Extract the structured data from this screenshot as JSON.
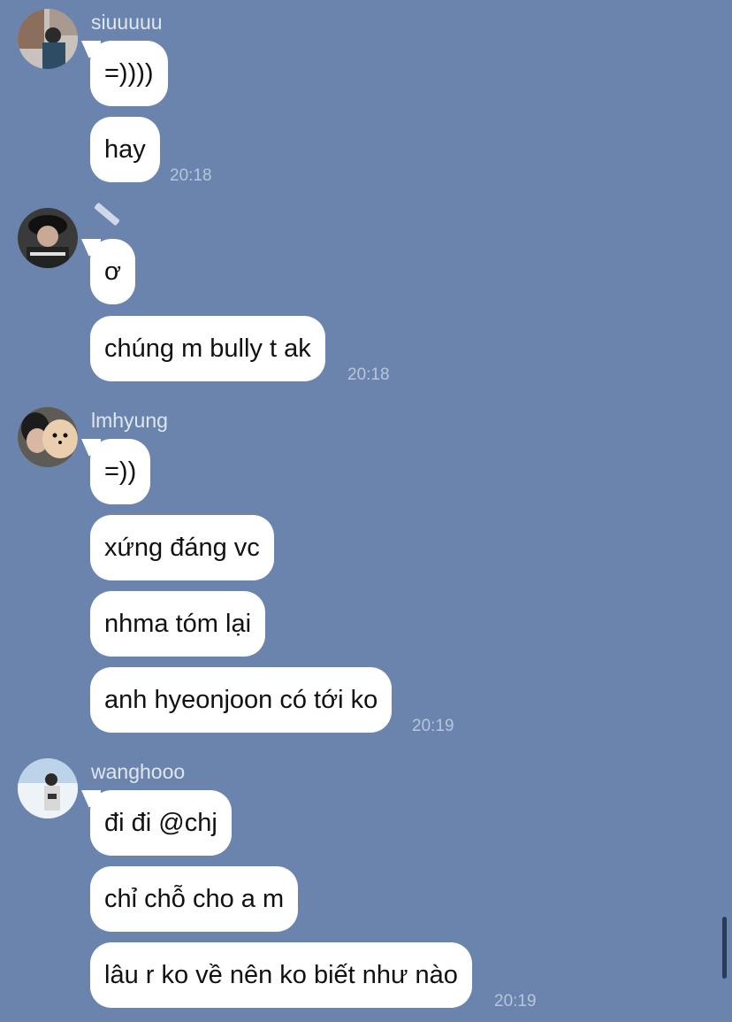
{
  "groups": [
    {
      "sender": "siuuuuu",
      "messages": [
        "=))))",
        "hay"
      ],
      "time": "20:18"
    },
    {
      "sender": "",
      "messages": [
        "ơ",
        "chúng m bully t ak"
      ],
      "time": "20:18"
    },
    {
      "sender": "lmhyung",
      "messages": [
        "=))",
        "xứng đáng vc",
        "nhma tóm lại",
        "anh hyeonjoon có tới ko"
      ],
      "time": "20:19"
    },
    {
      "sender": "wanghooo",
      "messages": [
        "đi đi @chj",
        "chỉ chỗ cho a m",
        "lâu r ko về nên ko biết như nào"
      ],
      "time": "20:19"
    }
  ],
  "icons": {
    "avatar_1": "avatar-photo-man-street",
    "avatar_2": "avatar-photo-man-black-hat",
    "avatar_3": "avatar-photo-man-with-dog",
    "avatar_4": "avatar-photo-man-snow",
    "sender_2_badge": "pencil-icon"
  },
  "colors": {
    "background": "#6a84ad",
    "bubble": "#ffffff",
    "timestamp": "#b8c6da",
    "sender_name": "#dfe6f0"
  }
}
